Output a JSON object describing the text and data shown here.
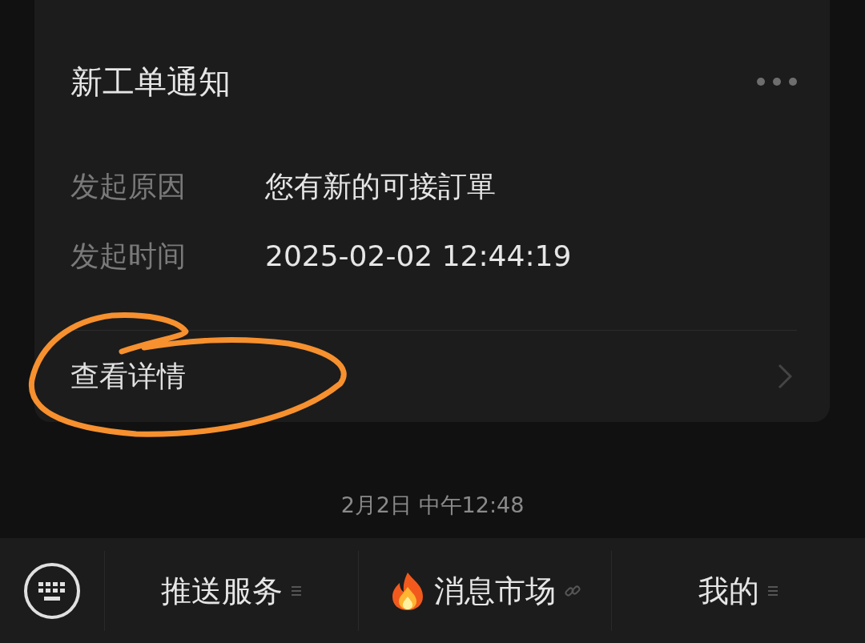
{
  "card": {
    "title": "新工单通知",
    "fields": [
      {
        "label": "发起原因",
        "value": "您有新的可接訂單"
      },
      {
        "label": "发起时间",
        "value": "2025-02-02 12:44:19"
      }
    ],
    "link": "查看详情"
  },
  "timestamp": "2月2日 中午12:48",
  "menu": [
    {
      "label": "推送服务",
      "kind": "submenu",
      "hot": false
    },
    {
      "label": "消息市场",
      "kind": "link",
      "hot": true
    },
    {
      "label": "我的",
      "kind": "submenu",
      "hot": false
    }
  ]
}
